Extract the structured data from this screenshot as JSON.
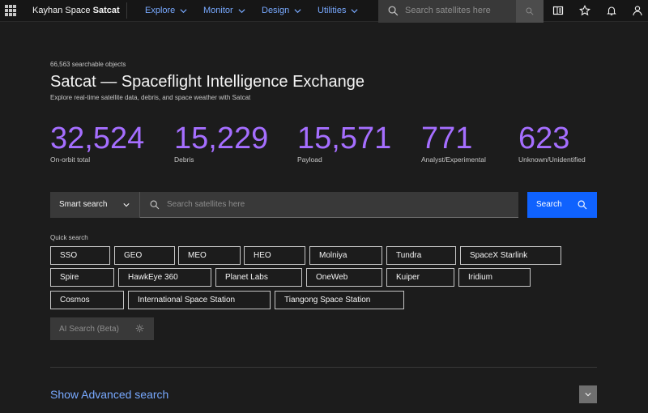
{
  "header": {
    "brand_prefix": "Kayhan Space ",
    "brand_name": "Satcat",
    "nav": [
      {
        "label": "Explore"
      },
      {
        "label": "Monitor"
      },
      {
        "label": "Design"
      },
      {
        "label": "Utilities"
      }
    ],
    "search_placeholder": "Search satellites here",
    "icons": [
      "grid-logo-icon",
      "search-icon",
      "panel-icon",
      "star-icon",
      "bell-icon",
      "user-icon"
    ]
  },
  "main": {
    "count_label": "66,563 searchable objects",
    "title": "Satcat — Spaceflight Intelligence Exchange",
    "subtitle": "Explore real-time satellite data, debris, and space weather with Satcat",
    "stats": [
      {
        "value": "32,524",
        "label": "On-orbit total"
      },
      {
        "value": "15,229",
        "label": "Debris"
      },
      {
        "value": "15,571",
        "label": "Payload"
      },
      {
        "value": "771",
        "label": "Analyst/Experimental"
      },
      {
        "value": "623",
        "label": "Unknown/Unidentified"
      }
    ],
    "stat_color": "#a56eff",
    "search": {
      "mode": "Smart search",
      "placeholder": "Search satellites here",
      "button_label": "Search"
    },
    "quick_search_label": "Quick search",
    "quick_search_chips": [
      "SSO",
      "GEO",
      "MEO",
      "HEO",
      "Molniya",
      "Tundra",
      "SpaceX Starlink",
      "Spire",
      "HawkEye 360",
      "Planet Labs",
      "OneWeb",
      "Kuiper",
      "Iridium",
      "Cosmos",
      "International Space Station",
      "Tiangong Space Station"
    ],
    "ai_search_label": "AI Search (Beta)",
    "advanced_search_label": "Show Advanced search"
  },
  "colors": {
    "accent_blue": "#0f62fe",
    "link_blue": "#78a9ff",
    "background": "#1c1c1c"
  }
}
